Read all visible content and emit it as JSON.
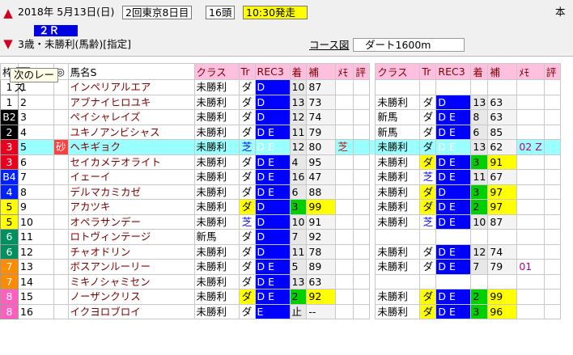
{
  "header": {
    "date": "2018年 5月13日(日)",
    "kai": "2回東京8日目",
    "heads": "16頭",
    "start": "10:30発走",
    "right_mark": "本",
    "race": "２Ｒ",
    "condition": "3歳・未勝利(馬齢)[指定]",
    "course_link": "コース図",
    "course": "ダート1600m"
  },
  "context_menu": {
    "label": "次のレース"
  },
  "columns": {
    "waku": "枠",
    "num": "",
    "mark": "◎",
    "name": "馬名S",
    "cur_class": "クラス",
    "cur_tr": "Tr",
    "cur_rec": "REC3",
    "cur_chaku": "着",
    "cur_ho": "補",
    "cur_memo": "ﾒﾓ",
    "cur_hyo": "評",
    "prev_class": "クラス",
    "prev_tr": "Tr",
    "prev_rec": "REC3",
    "prev_chaku": "着",
    "prev_ho": "補",
    "prev_memo": "ﾒﾓ",
    "prev_hyo": "評"
  },
  "waku_colors": {
    "1": "#ffffff",
    "2": "#000000",
    "3": "#e8001c",
    "4": "#0020ff",
    "5": "#ffff00",
    "6": "#009060",
    "7": "#ff8c00",
    "8": "#ff60c0"
  },
  "rows": [
    {
      "waku_label": "1",
      "waku": "1",
      "num": "1",
      "tag": "",
      "name": "インペリアルエア",
      "c1": "未勝利",
      "t1": "ダ",
      "r1": "D",
      "k1": "10",
      "h1": "87",
      "m1": "",
      "c2": "",
      "t2": "",
      "r2": "",
      "k2": "",
      "h2": "",
      "m2": ""
    },
    {
      "waku_label": "1",
      "waku": "1",
      "num": "2",
      "tag": "",
      "name": "アブナイヒロユキ",
      "c1": "未勝利",
      "t1": "ダ",
      "r1": "D",
      "k1": "13",
      "h1": "73",
      "m1": "",
      "c2": "未勝利",
      "t2": "ダ",
      "r2": "D",
      "k2": "13",
      "h2": "63",
      "m2": ""
    },
    {
      "waku_label": "B2",
      "waku": "2",
      "num": "3",
      "tag": "",
      "name": "ペイシャレイズ",
      "c1": "未勝利",
      "t1": "ダ",
      "r1": "D",
      "k1": "12",
      "h1": "74",
      "m1": "",
      "c2": "新馬",
      "t2": "ダ",
      "r2": "D E",
      "k2": "8",
      "h2": "63",
      "m2": ""
    },
    {
      "waku_label": "2",
      "waku": "2",
      "num": "4",
      "tag": "",
      "name": "ユキノアンビシャス",
      "c1": "未勝利",
      "t1": "ダ",
      "r1": "D E",
      "k1": "11",
      "h1": "79",
      "m1": "",
      "c2": "新馬",
      "t2": "ダ",
      "r2": "D E",
      "k2": "6",
      "h2": "85",
      "m2": ""
    },
    {
      "waku_label": "3",
      "waku": "3",
      "num": "5",
      "tag": "砂",
      "name": "ヘキギョク",
      "c1": "未勝利",
      "t1": "芝",
      "r1": "D E",
      "k1": "12",
      "h1": "80",
      "m1": "芝",
      "c2": "未勝利",
      "t2": "ダ",
      "r2": "D E",
      "k2": "13",
      "h2": "62",
      "m2": "02 Z"
    },
    {
      "waku_label": "3",
      "waku": "3",
      "num": "6",
      "tag": "",
      "name": "セイカメテオライト",
      "c1": "未勝利",
      "t1": "ダ",
      "r1": "D E",
      "k1": "4",
      "h1": "95",
      "m1": "",
      "c2": "未勝利",
      "t2": "ダ",
      "r2": "D E",
      "k2": "3",
      "h2": "91",
      "m2": ""
    },
    {
      "waku_label": "B4",
      "waku": "4",
      "num": "7",
      "tag": "",
      "name": "イェーイ",
      "c1": "未勝利",
      "t1": "ダ",
      "r1": "D E",
      "k1": "16",
      "h1": "47",
      "m1": "",
      "c2": "未勝利",
      "t2": "芝",
      "r2": "D E",
      "k2": "11",
      "h2": "67",
      "m2": ""
    },
    {
      "waku_label": "4",
      "waku": "4",
      "num": "8",
      "tag": "",
      "name": "デルマカミカゼ",
      "c1": "未勝利",
      "t1": "ダ",
      "r1": "D E",
      "k1": "6",
      "h1": "88",
      "m1": "",
      "c2": "未勝利",
      "t2": "ダ",
      "r2": "D",
      "k2": "3",
      "h2": "97",
      "m2": ""
    },
    {
      "waku_label": "5",
      "waku": "5",
      "num": "9",
      "tag": "",
      "name": "アカツキ",
      "c1": "未勝利",
      "t1": "ダ",
      "r1": "D",
      "k1": "3",
      "h1": "99",
      "m1": "",
      "c2": "未勝利",
      "t2": "ダ",
      "r2": "D E",
      "k2": "2",
      "h2": "97",
      "m2": ""
    },
    {
      "waku_label": "5",
      "waku": "5",
      "num": "10",
      "tag": "",
      "name": "オペラサンデー",
      "c1": "未勝利",
      "t1": "芝",
      "r1": "D",
      "k1": "10",
      "h1": "91",
      "m1": "",
      "c2": "未勝利",
      "t2": "芝",
      "r2": "D E",
      "k2": "10",
      "h2": "87",
      "m2": ""
    },
    {
      "waku_label": "6",
      "waku": "6",
      "num": "11",
      "tag": "",
      "name": "ロトヴィンテージ",
      "c1": "新馬",
      "t1": "ダ",
      "r1": "D",
      "k1": "7",
      "h1": "92",
      "m1": "",
      "c2": "",
      "t2": "",
      "r2": "",
      "k2": "",
      "h2": "",
      "m2": ""
    },
    {
      "waku_label": "6",
      "waku": "6",
      "num": "12",
      "tag": "",
      "name": "チャオドリン",
      "c1": "未勝利",
      "t1": "ダ",
      "r1": "D",
      "k1": "11",
      "h1": "78",
      "m1": "",
      "c2": "未勝利",
      "t2": "ダ",
      "r2": "D E",
      "k2": "12",
      "h2": "74",
      "m2": ""
    },
    {
      "waku_label": "7",
      "waku": "7",
      "num": "13",
      "tag": "",
      "name": "ボスアンルーリー",
      "c1": "未勝利",
      "t1": "ダ",
      "r1": "D E",
      "k1": "5",
      "h1": "89",
      "m1": "",
      "c2": "未勝利",
      "t2": "ダ",
      "r2": "D E",
      "k2": "7",
      "h2": "79",
      "m2": "01"
    },
    {
      "waku_label": "7",
      "waku": "7",
      "num": "14",
      "tag": "",
      "name": "ミキノシャミセン",
      "c1": "未勝利",
      "t1": "ダ",
      "r1": "D E",
      "k1": "13",
      "h1": "63",
      "m1": "",
      "c2": "",
      "t2": "",
      "r2": "",
      "k2": "",
      "h2": "",
      "m2": ""
    },
    {
      "waku_label": "8",
      "waku": "8",
      "num": "15",
      "tag": "",
      "name": "ノーザンクリス",
      "c1": "未勝利",
      "t1": "ダ",
      "r1": "D E",
      "k1": "2",
      "h1": "92",
      "m1": "",
      "c2": "未勝利",
      "t2": "ダ",
      "r2": "D E",
      "k2": "2",
      "h2": "99",
      "m2": ""
    },
    {
      "waku_label": "8",
      "waku": "8",
      "num": "16",
      "tag": "",
      "name": "イクヨロブロイ",
      "c1": "未勝利",
      "t1": "ダ",
      "r1": "E",
      "k1": "止",
      "h1": "--",
      "m1": "",
      "c2": "未勝利",
      "t2": "ダ",
      "r2": "D E",
      "k2": "3",
      "h2": "96",
      "m2": ""
    }
  ]
}
